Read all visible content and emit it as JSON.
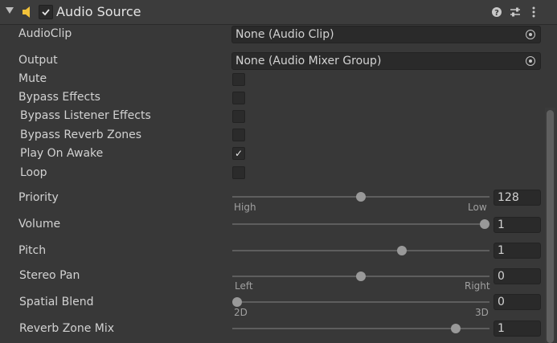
{
  "component": {
    "title": "Audio Source",
    "enabled": true
  },
  "fields": {
    "audio_clip": {
      "label": "AudioClip",
      "value": "None (Audio Clip)"
    },
    "output": {
      "label": "Output",
      "value": "None (Audio Mixer Group)"
    }
  },
  "toggles": [
    {
      "label": "Mute",
      "checked": false
    },
    {
      "label": "Bypass Effects",
      "checked": false
    },
    {
      "label": "Bypass Listener Effects",
      "checked": false
    },
    {
      "label": "Bypass Reverb Zones",
      "checked": false
    },
    {
      "label": "Play On Awake",
      "checked": true,
      "mark": "✓"
    },
    {
      "label": "Loop",
      "checked": false
    }
  ],
  "sliders": [
    {
      "label": "Priority",
      "value": "128",
      "fraction": 0.5,
      "min_label": "High",
      "max_label": "Low"
    },
    {
      "label": "Volume",
      "value": "1",
      "fraction": 1.0
    },
    {
      "label": "Pitch",
      "value": "1",
      "fraction": 0.66
    },
    {
      "label": "Stereo Pan",
      "value": "0",
      "fraction": 0.5,
      "min_label": "Left",
      "max_label": "Right"
    },
    {
      "label": "Spatial Blend",
      "value": "0",
      "fraction": 0.0,
      "min_label": "2D",
      "max_label": "3D"
    },
    {
      "label": "Reverb Zone Mix",
      "value": "1",
      "fraction": 0.87
    }
  ],
  "icons": {
    "foldout": "triangle-down-icon",
    "component": "speaker-icon",
    "help": "help-icon",
    "presets": "presets-icon",
    "menu": "kebab-menu-icon"
  },
  "colors": {
    "speaker": "#f2c23a",
    "background": "#383838"
  }
}
